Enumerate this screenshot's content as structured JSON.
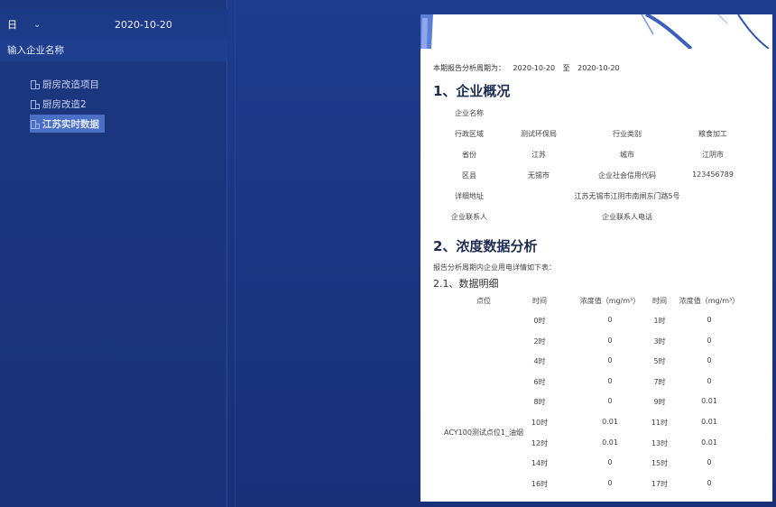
{
  "sidebar": {
    "period_select": "日",
    "date": "2020-10-20",
    "search_placeholder": "输入企业名称",
    "tree": [
      {
        "label": "厨房改造项目"
      },
      {
        "label": "厨房改造2"
      },
      {
        "label": "江苏实时数据"
      }
    ]
  },
  "report": {
    "period_label": "本期报告分析周期为：",
    "period_start": "2020-10-20",
    "period_sep": "至",
    "period_end": "2020-10-20",
    "section1_title": "1、企业概况",
    "overview": {
      "company_name_label": "企业名称",
      "admin_area_label": "行政区域",
      "admin_area_value": "测试环保局",
      "industry_label": "行业类别",
      "industry_value": "粮食加工",
      "province_label": "省份",
      "province_value": "江苏",
      "city_label": "城市",
      "city_value": "江阴市",
      "county_label": "区县",
      "county_value": "无锡市",
      "credit_code_label": "企业社会信用代码",
      "credit_code_value": "123456789",
      "address_label": "详细地址",
      "address_value": "江苏无锡市江阴市南闸东门路5号",
      "contact_label": "企业联系人",
      "contact_phone_label": "企业联系人电话"
    },
    "section2_title": "2、浓度数据分析",
    "section2_desc": "报告分析周期内企业用电详情如下表：",
    "subsection_title": "2.1、数据明细",
    "detail_headers": {
      "point": "点位",
      "time1": "时间",
      "value1": "浓度值（mg/m³）",
      "time2": "时间",
      "value2": "浓度值（mg/m³）"
    },
    "point_name": "ACY100测试点位1_油烟",
    "rows": [
      {
        "t1": "0时",
        "v1": "0",
        "t2": "1时",
        "v2": "0"
      },
      {
        "t1": "2时",
        "v1": "0",
        "t2": "3时",
        "v2": "0"
      },
      {
        "t1": "4时",
        "v1": "0",
        "t2": "5时",
        "v2": "0"
      },
      {
        "t1": "6时",
        "v1": "0",
        "t2": "7时",
        "v2": "0"
      },
      {
        "t1": "8时",
        "v1": "0",
        "t2": "9时",
        "v2": "0.01"
      },
      {
        "t1": "10时",
        "v1": "0.01",
        "t2": "11时",
        "v2": "0.01"
      },
      {
        "t1": "12时",
        "v1": "0.01",
        "t2": "13时",
        "v2": "0.01"
      },
      {
        "t1": "14时",
        "v1": "0",
        "t2": "15时",
        "v2": "0"
      },
      {
        "t1": "16时",
        "v1": "0",
        "t2": "17时",
        "v2": "0"
      }
    ]
  }
}
